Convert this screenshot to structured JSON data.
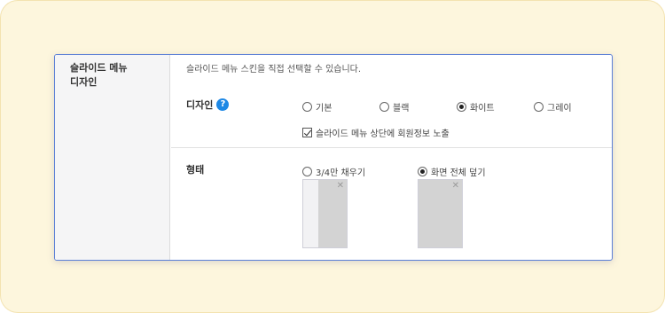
{
  "side": {
    "title_line1": "슬라이드 메뉴",
    "title_line2": "디자인"
  },
  "content": {
    "description": "슬라이드 메뉴 스킨을 직접 선택할 수 있습니다.",
    "design": {
      "label": "디자인",
      "help_glyph": "?",
      "options": [
        {
          "label": "기본",
          "selected": false
        },
        {
          "label": "블랙",
          "selected": false
        },
        {
          "label": "화이트",
          "selected": true
        },
        {
          "label": "그레이",
          "selected": false
        }
      ],
      "show_member_info": {
        "label": "슬라이드 메뉴 상단에 회원정보 노출",
        "checked": true
      }
    },
    "layout": {
      "label": "형태",
      "options": [
        {
          "label": "3/4만 채우기",
          "selected": false,
          "fill_fraction": 0.66
        },
        {
          "label": "화면 전체 덮기",
          "selected": true,
          "fill_fraction": 1.0
        }
      ],
      "close_glyph": "✕"
    }
  },
  "colors": {
    "accent": "#5b7fd6",
    "help": "#1e88e5",
    "background": "#fdf6dd"
  }
}
